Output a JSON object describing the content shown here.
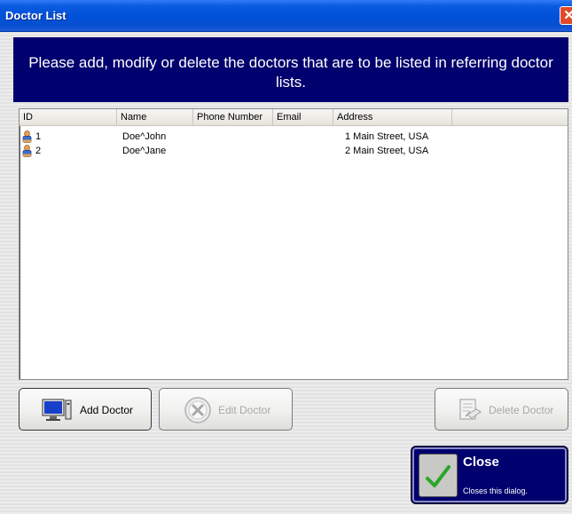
{
  "window": {
    "title": "Doctor List",
    "close_icon": "close-icon"
  },
  "banner": {
    "text": "Please add, modify or delete the doctors that are to be listed in referring doctor lists."
  },
  "table": {
    "columns": [
      "ID",
      "Name",
      "Phone Number",
      "Email",
      "Address"
    ],
    "rows": [
      {
        "id": "1",
        "name": "Doe^John",
        "phone": "",
        "email": "",
        "address": "1 Main Street, USA"
      },
      {
        "id": "2",
        "name": "Doe^Jane",
        "phone": "",
        "email": "",
        "address": "2 Main Street, USA"
      }
    ]
  },
  "buttons": {
    "add": {
      "label": "Add Doctor",
      "icon": "monitor-icon"
    },
    "edit": {
      "label": "Edit Doctor",
      "icon": "x-circle-icon",
      "enabled": false
    },
    "delete": {
      "label": "Delete Doctor",
      "icon": "delete-doc-icon",
      "enabled": false
    },
    "close": {
      "label": "Close",
      "description": "Closes this dialog.",
      "icon": "checkmark-icon"
    }
  },
  "colors": {
    "titlebar": "#0050d8",
    "banner": "#00006e",
    "close_button": "#00006e",
    "check": "#2aa52a"
  }
}
